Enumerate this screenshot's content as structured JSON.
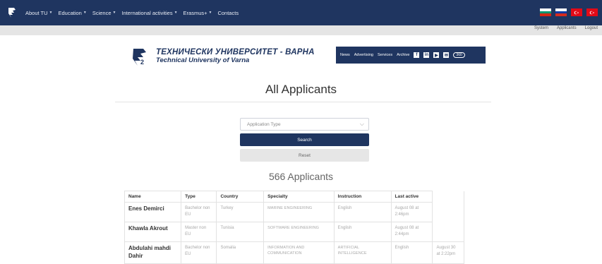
{
  "topnav": {
    "items": [
      {
        "label": "About TU",
        "caret": true
      },
      {
        "label": "Education",
        "caret": true
      },
      {
        "label": "Science",
        "caret": true
      },
      {
        "label": "International activities",
        "caret": true
      },
      {
        "label": "Erasmus+",
        "caret": true
      },
      {
        "label": "Contacts",
        "caret": false
      }
    ]
  },
  "flags": [
    "bulgarian-flag",
    "russian-flag",
    "turkish-flag",
    "turkish-flag-2"
  ],
  "userlinks": {
    "system": "System",
    "applicants": "Applicants",
    "logout": "Logout"
  },
  "brand": {
    "line1": "ТЕХНИЧЕСКИ УНИВЕРСИТЕТ - ВАРНА",
    "line2": "Technical University of Varna"
  },
  "bluebar": {
    "news": "News",
    "advertising": "Advertising",
    "services": "Services",
    "archive": "Archive",
    "badge": "360"
  },
  "page": {
    "title": "All Applicants",
    "count": "566 Applicants"
  },
  "filters": {
    "type_placeholder": "Application Type",
    "search": "Search",
    "reset": "Reset"
  },
  "table": {
    "headers": [
      "Name",
      "Type",
      "Country",
      "Specialty",
      "Instruction",
      "Last active"
    ],
    "rows": [
      {
        "name": "Enes Demirci",
        "type": "Bachelor non EU",
        "country": "Turkey",
        "specialty": "MARINE ENGINEERING",
        "instruction": "English",
        "last_active": "August 08 at 2:46pm",
        "extra": ""
      },
      {
        "name": "Khawla Akrout",
        "type": "Master non EU",
        "country": "Tunisia",
        "specialty": "SOFTWARE ENGINEERING",
        "instruction": "English",
        "last_active": "August 08 at 2:44pm",
        "extra": ""
      },
      {
        "name": "Abdulahi mahdi Dahir",
        "type": "Bachelor non EU",
        "country": "Somalia",
        "specialty": "INFORMATION AND COMMUNICATION",
        "instruction": "ARTIFICIAL INTELLIGENCE",
        "last_active": "English",
        "extra": "August 30 at 2:22pm"
      }
    ]
  }
}
